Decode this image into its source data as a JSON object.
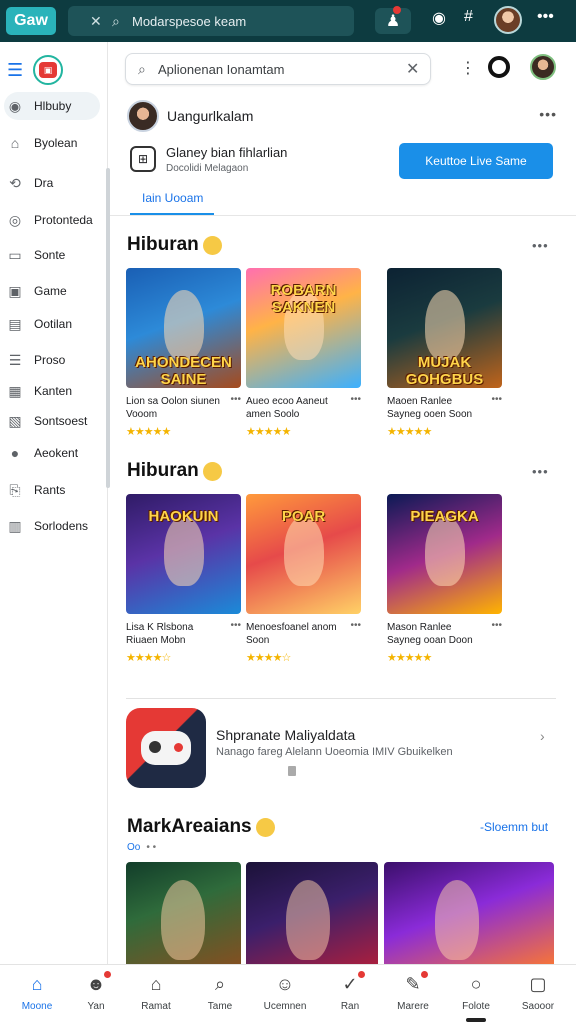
{
  "topbar": {
    "logo": "Gaw",
    "search_text": "Modarspesoe keam"
  },
  "sidebar": {
    "items": [
      {
        "label": "Hlbuby",
        "icon": "chat-bubble-icon",
        "glyph": "◉",
        "active": true
      },
      {
        "label": "Byolean",
        "icon": "home-icon",
        "glyph": "⌂"
      },
      {
        "label": "Dra",
        "icon": "link-icon",
        "glyph": "⟲"
      },
      {
        "label": "Protonteda",
        "icon": "target-icon",
        "glyph": "◎"
      },
      {
        "label": "Sonte",
        "icon": "monitor-icon",
        "glyph": "▭"
      },
      {
        "label": "Game",
        "icon": "briefcase-icon",
        "glyph": "▣"
      },
      {
        "label": "Ootilan",
        "icon": "window-icon",
        "glyph": "▤"
      },
      {
        "label": "Proso",
        "icon": "list-icon",
        "glyph": "☰"
      },
      {
        "label": "Kanten",
        "icon": "folder-icon",
        "glyph": "▦"
      },
      {
        "label": "Sontsoest",
        "icon": "gallery-icon",
        "glyph": "▧"
      },
      {
        "label": "Aeokent",
        "icon": "circle-dot-icon",
        "glyph": "●"
      },
      {
        "label": "Rants",
        "icon": "bookmark-icon",
        "glyph": "⎘"
      },
      {
        "label": "Sorlodens",
        "icon": "calendar-icon",
        "glyph": "▥"
      }
    ]
  },
  "header": {
    "search_text": "Aplionenan Ionamtam"
  },
  "profile": {
    "name": "Uangurlkalam",
    "game_title": "Glaney bian fihlarlian",
    "game_sub": "Docolidi Melagaon",
    "live_button": "Keuttoe Live Same",
    "tab_label": "Iain Uooam"
  },
  "sections": [
    {
      "title": "Hiburan",
      "cards": [
        {
          "name": "Lion sa Oolon siunen Vooom",
          "stars": "★★★★★",
          "thumb_title": "AHONDECEN SAINE",
          "bg": "linear-gradient(160deg,#1a5fb4 0%,#2d8ad8 45%,#a64a1c 100%)"
        },
        {
          "name": "Aueo ecoo Aaneut amen Soolo",
          "stars": "★★★★★",
          "thumb_title": "ROBARN SAKNEN",
          "bg": "linear-gradient(160deg,#ff6fb0 0%,#ffb347 40%,#3bb0ff 100%)"
        },
        {
          "name": "Maoen Ranlee Sayneg ooen Soon",
          "stars": "★★★★★",
          "thumb_title": "MUJAK GOHGBUS",
          "bg": "linear-gradient(160deg,#0c2233 0%,#1a3b3f 45%,#c0641b 100%)"
        }
      ]
    },
    {
      "title": "Hiburan",
      "cards": [
        {
          "name": "Lisa K Rlsbona Riuaen Mobn",
          "stars": "★★★★☆",
          "thumb_title": "HAOKUIN",
          "bg": "linear-gradient(160deg,#2f1b66 0%,#5a33a6 45%,#1b8ad8 100%)"
        },
        {
          "name": "Menoesfoanel anom Soon",
          "stars": "★★★★☆",
          "thumb_title": "POAR",
          "bg": "linear-gradient(160deg,#ff9a3c 0%,#e64a4a 45%,#ffd166 100%)"
        },
        {
          "name": "Mason Ranlee Sayneg ooan Doon",
          "stars": "★★★★★",
          "thumb_title": "PIEAGKA",
          "bg": "linear-gradient(160deg,#0b1a55 0%,#a02a8a 50%,#ffb400 100%)"
        }
      ]
    }
  ],
  "promo": {
    "title": "Shpranate Maliyaldata",
    "sub": "Nanago fareg Alelann Uoeomia IMIV Gbuikelken"
  },
  "market": {
    "title": "MarkAreaians",
    "link": "-Sloemm but",
    "sub": "Oo",
    "cards": [
      {
        "bg": "linear-gradient(160deg,#123d2a 0%,#2f6b3b 40%,#8a4d1f 100%)"
      },
      {
        "bg": "linear-gradient(160deg,#1b1238 0%,#3b1f6b 45%,#b31f3a 100%)"
      },
      {
        "bg": "linear-gradient(160deg,#3b0f6b 0%,#8a2bd8 45%,#ff7a2b 100%)"
      }
    ]
  },
  "bottom_nav": [
    {
      "label": "Moone",
      "icon": "home-icon",
      "glyph": "⌂",
      "active": true
    },
    {
      "label": "Yan",
      "icon": "person-icon",
      "glyph": "☻",
      "badge": true
    },
    {
      "label": "Ramat",
      "icon": "store-icon",
      "glyph": "⌂"
    },
    {
      "label": "Tame",
      "icon": "search-icon",
      "glyph": "⌕"
    },
    {
      "label": "Ucemnen",
      "icon": "game-icon",
      "glyph": "☺"
    },
    {
      "label": "Ran",
      "icon": "check-icon",
      "glyph": "✓",
      "badge": true
    },
    {
      "label": "Marere",
      "icon": "edit-icon",
      "glyph": "✎",
      "badge": true
    },
    {
      "label": "Folote",
      "icon": "circle-icon",
      "glyph": "○"
    },
    {
      "label": "Saooor",
      "icon": "message-icon",
      "glyph": "▢"
    }
  ]
}
